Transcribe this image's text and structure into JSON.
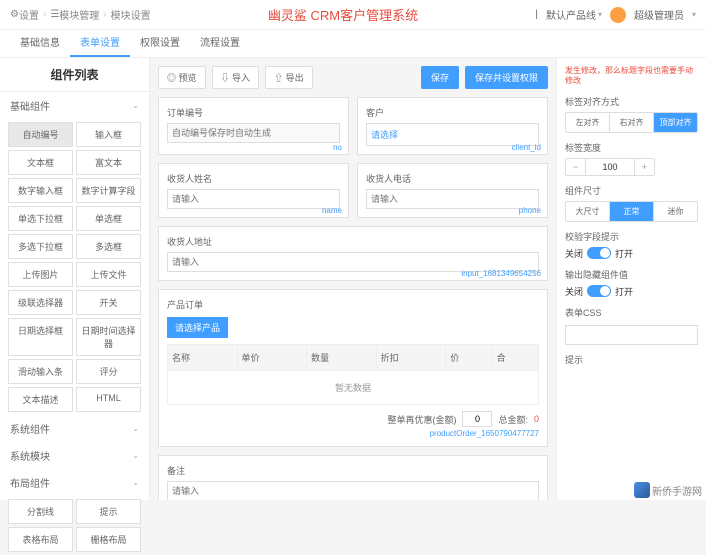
{
  "breadcrumb": {
    "settings": "设置",
    "module_mgmt": "模块管理",
    "module_cfg": "模块设置"
  },
  "app_title": "幽灵鲨 CRM客户管理系统",
  "top_right": {
    "product_line": "默认产品线",
    "user": "超级管理员"
  },
  "tabs": {
    "basic": "基础信息",
    "form": "表单设置",
    "perm": "权限设置",
    "flow": "流程设置"
  },
  "left": {
    "title": "组件列表",
    "sec_basic": "基础组件",
    "items": [
      "自动编号",
      "输入框",
      "文本框",
      "富文本",
      "数字输入框",
      "数字计算字段",
      "单选下拉框",
      "单选框",
      "多选下拉框",
      "多选框",
      "上传图片",
      "上传文件",
      "级联选择器",
      "开关",
      "日期选择框",
      "日期时间选择器",
      "滑动输入条",
      "评分",
      "文本描述",
      "HTML"
    ],
    "sec_sys_comp": "系统组件",
    "sec_sys_mod": "系统模块",
    "sec_layout": "布局组件",
    "layout_items": [
      "分割线",
      "提示",
      "表格布局",
      "栅格布局"
    ]
  },
  "center": {
    "preview": "预览",
    "import": "导入",
    "export": "导出",
    "save": "保存",
    "save_perm": "保存并设置权限",
    "order_no": {
      "label": "订单编号",
      "ph": "自动编号保存时自动生成",
      "id": "no"
    },
    "customer": {
      "label": "客户",
      "ph": "请选择",
      "id": "client_id"
    },
    "recv_name": {
      "label": "收货人姓名",
      "ph": "请输入",
      "id": "name"
    },
    "recv_phone": {
      "label": "收货人电话",
      "ph": "请输入",
      "id": "phone"
    },
    "recv_addr": {
      "label": "收货人地址",
      "ph": "请输入",
      "id": "input_1681349654256"
    },
    "prod_order": {
      "title": "产品订单",
      "select_btn": "请选择产品",
      "cols": [
        "名称",
        "单价",
        "数量",
        "折扣",
        "价",
        "合"
      ],
      "empty": "暂无数据",
      "discount_label": "整单再优惠(金额)",
      "discount_val": "0",
      "total_label": "总金额:",
      "total_val": "0",
      "id": "productOrder_1650790477727"
    },
    "remark": {
      "label": "备注",
      "ph": "请输入"
    }
  },
  "right": {
    "warn": "发生修改，那么标题字段也需要手动修改",
    "align_label": "标签对齐方式",
    "align": {
      "left": "左对齐",
      "right": "右对齐",
      "top": "顶部对齐"
    },
    "width_label": "标签宽度",
    "width_val": "100",
    "size_label": "组件尺寸",
    "size": {
      "large": "大尺寸",
      "normal": "正常",
      "mini": "迷你"
    },
    "valid_label": "校验字段提示",
    "off": "关闭",
    "on": "打开",
    "hidden_label": "输出隐藏组件值",
    "css_label": "表单CSS",
    "tip_label": "提示"
  },
  "watermark": "新侨手游网"
}
